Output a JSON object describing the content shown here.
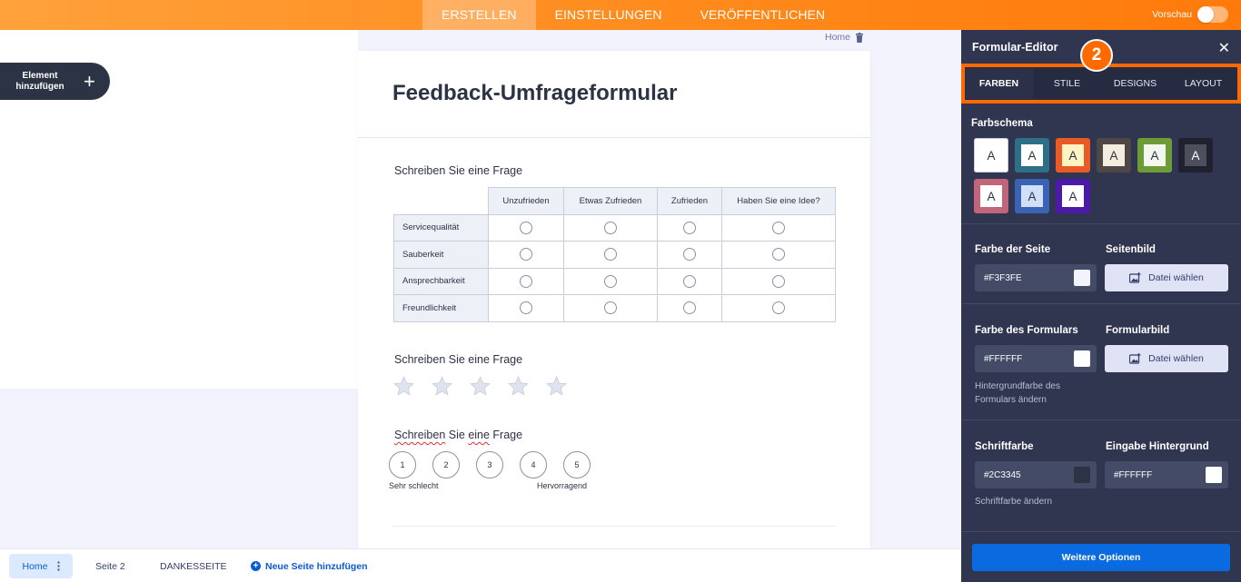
{
  "topbar": {
    "tabs": [
      {
        "label": "ERSTELLEN",
        "active": true
      },
      {
        "label": "EINSTELLUNGEN",
        "active": false
      },
      {
        "label": "VERÖFFENTLICHEN",
        "active": false
      }
    ],
    "preview_label": "Vorschau",
    "preview_on": false
  },
  "sidebar": {
    "add_element_line1": "Element",
    "add_element_line2": "hinzufügen"
  },
  "breadcrumb": {
    "page": "Home"
  },
  "form": {
    "title": "Feedback-Umfrageformular",
    "q1": {
      "label": "Schreiben Sie eine Frage",
      "columns": [
        "Unzufrieden",
        "Etwas Zufrieden",
        "Zufrieden",
        "Haben Sie eine Idee?"
      ],
      "rows": [
        "Servicequalität",
        "Sauberkeit",
        "Ansprechbarkeit",
        "Freundlichkeit"
      ]
    },
    "q2": {
      "label": "Schreiben Sie eine Frage",
      "stars": 5
    },
    "q3": {
      "label_part1": "Schreiben",
      "label_part2": " Sie ",
      "label_part3": "eine",
      "label_part4": " Frage",
      "options": [
        "1",
        "2",
        "3",
        "4",
        "5"
      ],
      "low_label": "Sehr schlecht",
      "high_label": "Hervorragend"
    }
  },
  "bottombar": {
    "pages": [
      {
        "label": "Home",
        "active": true
      },
      {
        "label": "Seite 2",
        "active": false
      },
      {
        "label": "DANKESSEITE",
        "active": false
      }
    ],
    "add_page": "Neue Seite hinzufügen"
  },
  "panel": {
    "title": "Formular-Editor",
    "step_badge": "2",
    "tabs": [
      {
        "label": "FARBEN",
        "active": true
      },
      {
        "label": "STILE",
        "active": false
      },
      {
        "label": "DESIGNS",
        "active": false
      },
      {
        "label": "LAYOUT",
        "active": false
      }
    ],
    "scheme_title": "Farbschema",
    "schemes": [
      {
        "outer": "#ffffff",
        "inner": "#ffffff",
        "text": "#2c3345",
        "letter": "A"
      },
      {
        "outer": "#2c6f86",
        "inner": "#ffffff",
        "text": "#2c3345",
        "letter": "A"
      },
      {
        "outer": "#e95b26",
        "inner": "#fff4c2",
        "text": "#2c3345",
        "letter": "A"
      },
      {
        "outer": "#4f4646",
        "inner": "#f4ecde",
        "text": "#2c3345",
        "letter": "A"
      },
      {
        "outer": "#6d9b35",
        "inner": "#f4f7ee",
        "text": "#2c3345",
        "letter": "A"
      },
      {
        "outer": "#1f2130",
        "inner": "#4c4f5c",
        "text": "#ffffff",
        "letter": "A"
      },
      {
        "outer": "#c2657b",
        "inner": "#ffffff",
        "text": "#2c3345",
        "letter": "A"
      },
      {
        "outer": "#3b63b5",
        "inner": "#cfe0f7",
        "text": "#2c3345",
        "letter": "A"
      },
      {
        "outer": "#4c1aa9",
        "inner": "#ffffff",
        "text": "#2c3345",
        "letter": "A"
      }
    ],
    "page_color": {
      "label": "Farbe der Seite",
      "value": "#F3F3FE",
      "chip": "#F3F3FE"
    },
    "page_image": {
      "label": "Seitenbild",
      "button": "Datei wählen"
    },
    "form_color": {
      "label": "Farbe des Formulars",
      "value": "#FFFFFF",
      "chip": "#FFFFFF",
      "hint_line1": "Hintergrundfarbe des",
      "hint_line2": "Formulars ändern"
    },
    "form_image": {
      "label": "Formularbild",
      "button": "Datei wählen"
    },
    "font_color": {
      "label": "Schriftfarbe",
      "value": "#2C3345",
      "chip": "#2C3345",
      "hint": "Schriftfarbe ändern"
    },
    "input_bg": {
      "label": "Eingabe Hintergrund",
      "value": "#FFFFFF",
      "chip": "#FFFFFF"
    },
    "more_button": "Weitere Optionen"
  }
}
